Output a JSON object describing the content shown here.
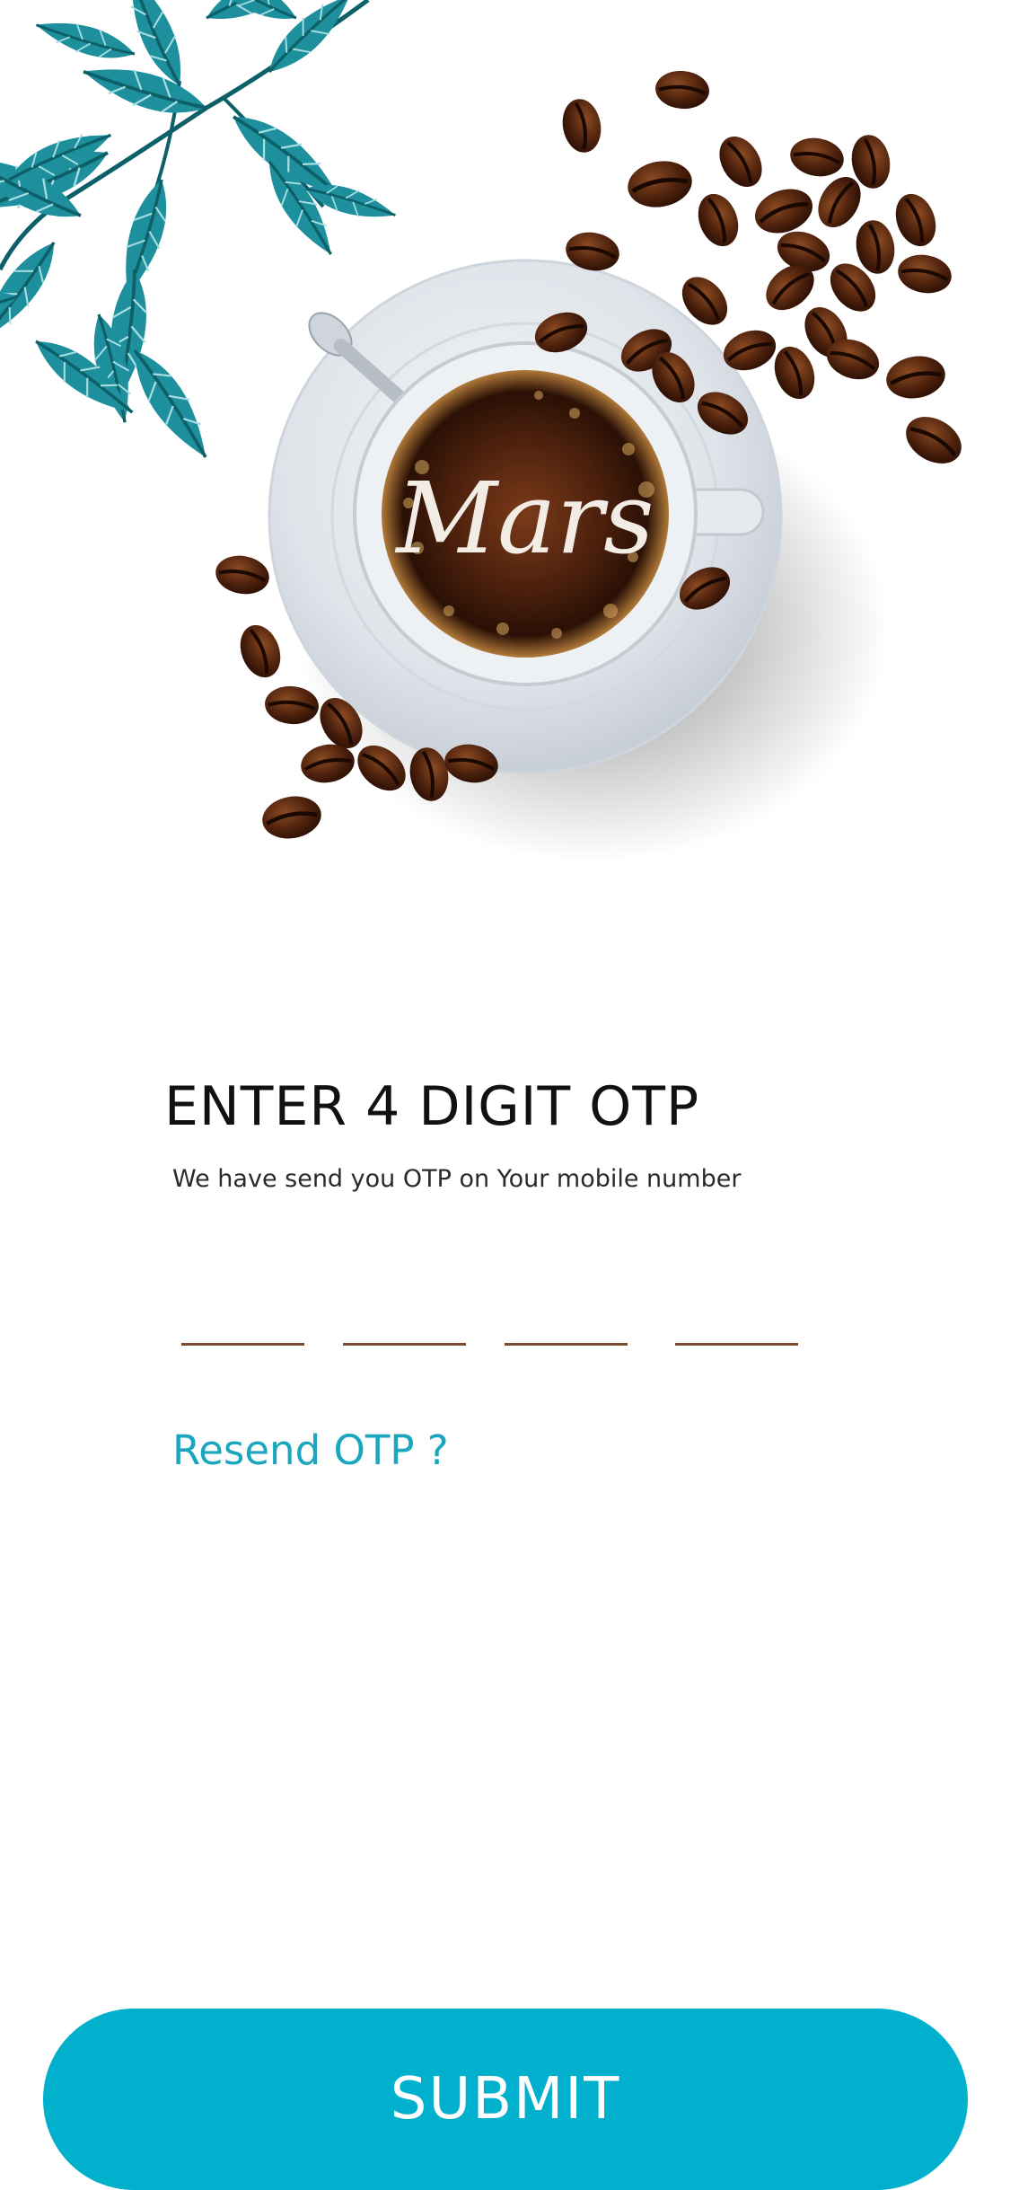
{
  "brand": {
    "logo_text": "Mars"
  },
  "otp": {
    "title": "ENTER 4 DIGIT OTP",
    "subtitle": "We have send you OTP on Your mobile number",
    "digits": [
      "",
      "",
      "",
      ""
    ],
    "resend_label": "Resend OTP ?"
  },
  "actions": {
    "submit_label": "SUBMIT"
  },
  "colors": {
    "accent": "#00b0cc",
    "resend": "#1aa6bf",
    "leaf": "#1e8f9c",
    "bean": "#5a2a14",
    "underline": "#7a4a2e"
  }
}
